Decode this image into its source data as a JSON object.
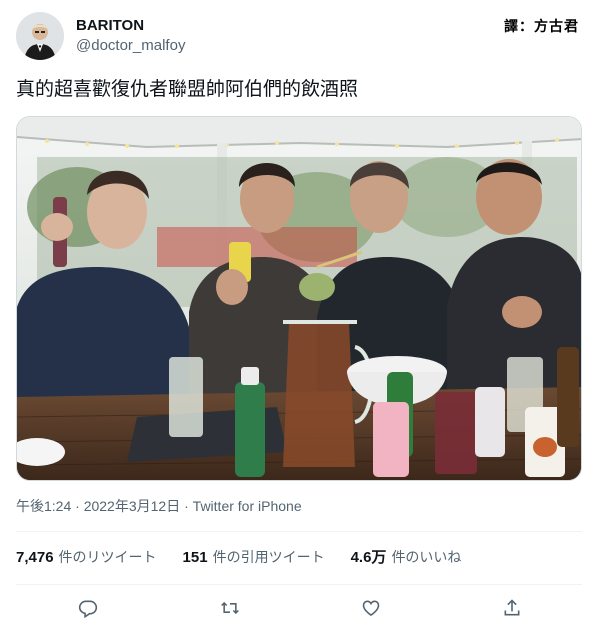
{
  "author": {
    "display_name": "BARITON",
    "handle": "@doctor_malfoy"
  },
  "watermark": "譯：方古君",
  "tweet": {
    "text": "真的超喜歡復仇者聯盟帥阿伯們的飲酒照"
  },
  "meta": {
    "time": "午後1:24",
    "sep1": " · ",
    "date": "2022年3月12日",
    "sep2": " · ",
    "source": "Twitter for iPhone"
  },
  "stats": {
    "retweets_count": "7,476",
    "retweets_label": "件のリツイート",
    "quotes_count": "151",
    "quotes_label": "件の引用ツイート",
    "likes_count": "4.6万",
    "likes_label": "件のいいね"
  },
  "colors": {
    "text_primary": "#0f1419",
    "text_secondary": "#536471",
    "divider": "#eff3f4",
    "icon": "#536471"
  },
  "icons": [
    "reply-icon",
    "retweet-icon",
    "like-icon",
    "share-icon"
  ]
}
